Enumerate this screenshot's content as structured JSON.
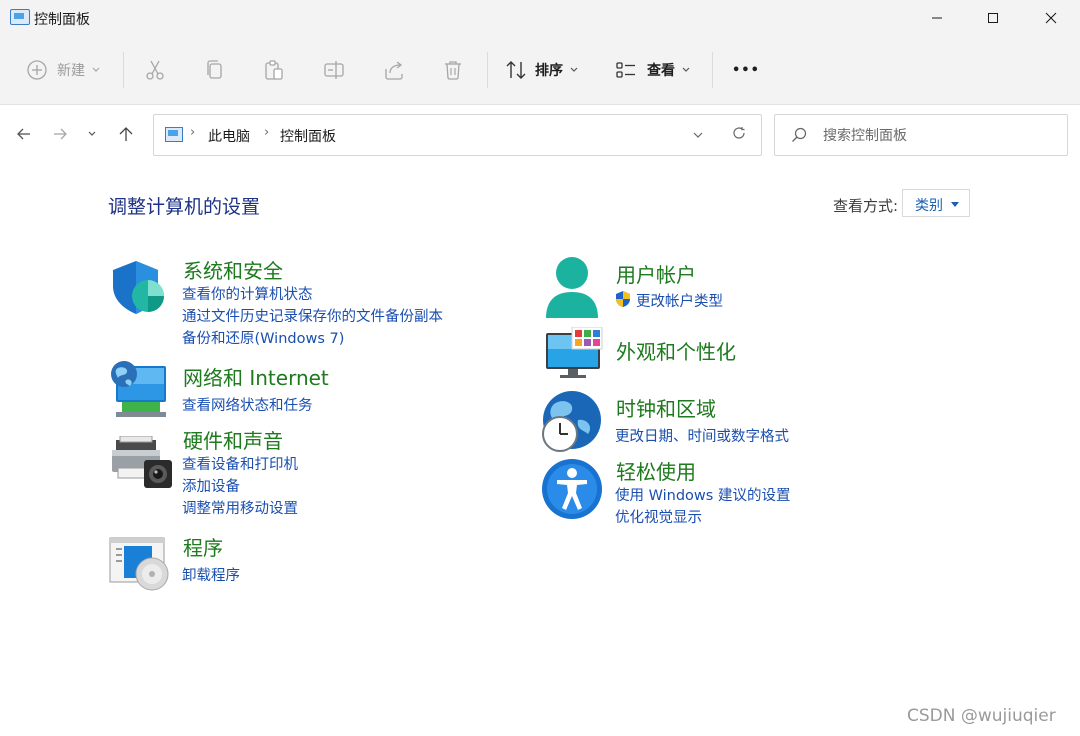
{
  "window": {
    "title": "控制面板"
  },
  "toolbar": {
    "new_label": "新建",
    "sort_label": "排序",
    "view_label": "查看",
    "more_label": "•••"
  },
  "address": {
    "crumbs": [
      "此电脑",
      "控制面板"
    ],
    "search_placeholder": "搜索控制面板"
  },
  "content": {
    "heading": "调整计算机的设置",
    "view_by_label": "查看方式:",
    "view_by_value": "类别",
    "categories": [
      {
        "title": "系统和安全",
        "links": [
          "查看你的计算机状态",
          "通过文件历史记录保存你的文件备份副本",
          "备份和还原(Windows 7)"
        ]
      },
      {
        "title": "网络和 Internet",
        "links": [
          "查看网络状态和任务"
        ]
      },
      {
        "title": "硬件和声音",
        "links": [
          "查看设备和打印机",
          "添加设备",
          "调整常用移动设置"
        ]
      },
      {
        "title": "程序",
        "links": [
          "卸载程序"
        ]
      },
      {
        "title": "用户帐户",
        "links": [
          "更改帐户类型"
        ]
      },
      {
        "title": "外观和个性化",
        "links": []
      },
      {
        "title": "时钟和区域",
        "links": [
          "更改日期、时间或数字格式"
        ]
      },
      {
        "title": "轻松使用",
        "links": [
          "使用 Windows 建议的设置",
          "优化视觉显示"
        ]
      }
    ]
  },
  "watermark": "CSDN @wujiuqier",
  "colors": {
    "link": "#1a4fb0",
    "category_title": "#1d7a1d",
    "heading": "#1e3287"
  }
}
